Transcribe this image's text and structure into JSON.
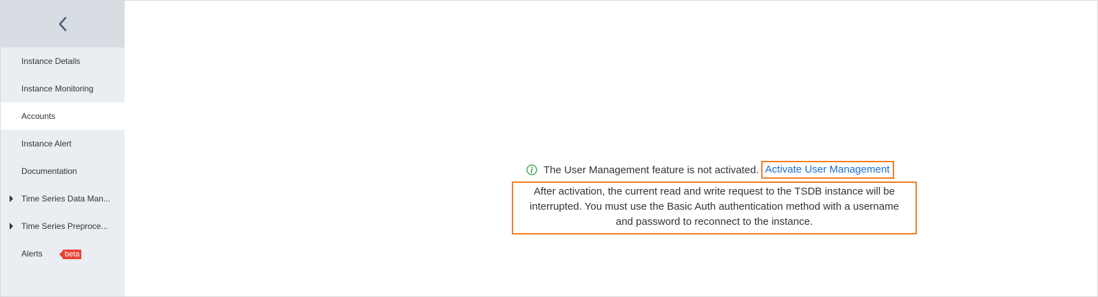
{
  "sidebar": {
    "back_icon": "chevron-left-icon",
    "items": [
      {
        "label": "Instance Details",
        "active": false,
        "expandable": false
      },
      {
        "label": "Instance Monitoring",
        "active": false,
        "expandable": false
      },
      {
        "label": "Accounts",
        "active": true,
        "expandable": false
      },
      {
        "label": "Instance Alert",
        "active": false,
        "expandable": false
      },
      {
        "label": "Documentation",
        "active": false,
        "expandable": false
      },
      {
        "label": "Time Series Data Man...",
        "active": false,
        "expandable": true
      },
      {
        "label": "Time Series Preproce...",
        "active": false,
        "expandable": true
      },
      {
        "label": "Alerts",
        "active": false,
        "expandable": false,
        "badge": "beta"
      }
    ]
  },
  "main": {
    "notice": {
      "icon": "info-circle-icon",
      "text": "The User Management feature is not activated.",
      "link_label": "Activate User Management"
    },
    "warning_lines": [
      "After activation, the current read and write request to the TSDB instance will be",
      "interrupted. You must use the Basic Auth authentication method with a username",
      "and password to reconnect to the instance."
    ]
  },
  "colors": {
    "sidebar_bg": "#eaedf1",
    "sidebar_header_bg": "#d8dde4",
    "link": "#1a6cd6",
    "highlight_border": "#f57c20",
    "info_icon": "#2e9e3e",
    "beta_badge": "#e84235"
  }
}
